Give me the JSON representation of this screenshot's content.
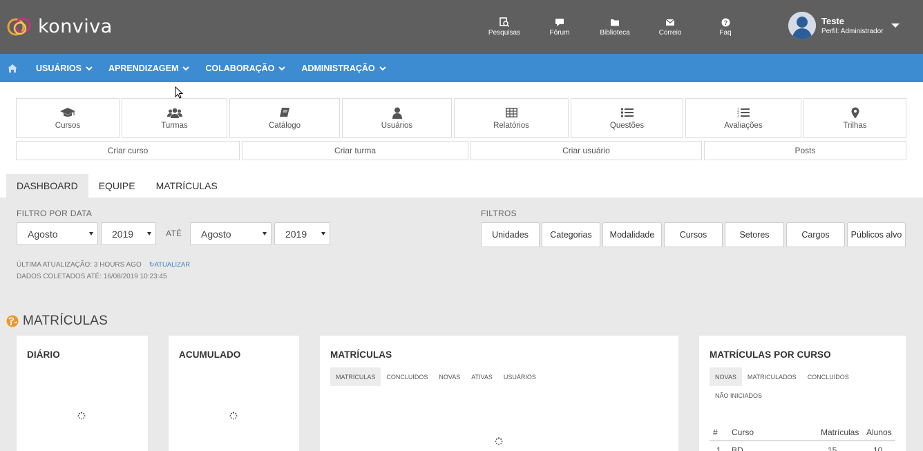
{
  "brand": {
    "name": "konviva"
  },
  "top_icons": [
    {
      "icon": "search-doc-icon",
      "label": "Pesquisas"
    },
    {
      "icon": "chat-icon",
      "label": "Fórum"
    },
    {
      "icon": "folder-icon",
      "label": "Biblioteca"
    },
    {
      "icon": "mail-icon",
      "label": "Correio"
    },
    {
      "icon": "question-icon",
      "label": "Faq"
    }
  ],
  "user": {
    "name": "Teste",
    "role": "Perfil: Administrador"
  },
  "nav": {
    "items": [
      {
        "label": "USUÁRIOS"
      },
      {
        "label": "APRENDIZAGEM"
      },
      {
        "label": "COLABORAÇÃO"
      },
      {
        "label": "ADMINISTRAÇÃO"
      }
    ]
  },
  "quick_tiles": [
    {
      "icon": "graduation-cap-icon",
      "label": "Cursos"
    },
    {
      "icon": "users-icon",
      "label": "Turmas"
    },
    {
      "icon": "book-icon",
      "label": "Catálogo"
    },
    {
      "icon": "user-icon",
      "label": "Usuários"
    },
    {
      "icon": "table-icon",
      "label": "Relatórios"
    },
    {
      "icon": "list-icon",
      "label": "Questões"
    },
    {
      "icon": "ordered-list-icon",
      "label": "Avaliações"
    },
    {
      "icon": "map-marker-icon",
      "label": "Trilhas"
    }
  ],
  "quick_buttons": [
    {
      "label": "Criar curso"
    },
    {
      "label": "Criar turma"
    },
    {
      "label": "Criar usuário"
    },
    {
      "label": "Posts"
    }
  ],
  "tabs": [
    {
      "label": "DASHBOARD"
    },
    {
      "label": "EQUIPE"
    },
    {
      "label": "MATRÍCULAS"
    }
  ],
  "date_filter": {
    "title": "FILTRO POR DATA",
    "from_month": "Agosto",
    "from_year": "2019",
    "until_label": "ATÉ",
    "to_month": "Agosto",
    "to_year": "2019"
  },
  "filters": {
    "title": "FILTROS",
    "buttons": [
      "Unidades",
      "Categorias",
      "Modalidade",
      "Cursos",
      "Setores",
      "Cargos",
      "Públicos alvo"
    ]
  },
  "meta": {
    "last_update": "ÚLTIMA ATUALIZAÇÃO: 3 HOURS AGO",
    "refresh": "ATUALIZAR",
    "collected": "DADOS COLETADOS ATÉ: 16/08/2019 10:23:45"
  },
  "section": {
    "title": "MATRÍCULAS"
  },
  "cards": {
    "diario": {
      "title": "DIÁRIO"
    },
    "acumulado": {
      "title": "ACUMULADO"
    },
    "matriculas": {
      "title": "MATRÍCULAS",
      "tabs": [
        "MATRÍCULAS",
        "CONCLUÍDOS",
        "NOVAS",
        "ATIVAS",
        "USUÁRIOS"
      ]
    },
    "por_curso": {
      "title": "MATRÍCULAS POR CURSO",
      "tabs": [
        "NOVAS",
        "MATRICULADOS",
        "CONCLUÍDOS",
        "NÃO INICIADOS"
      ],
      "columns": [
        "#",
        "Curso",
        "Matrículas",
        "Alunos"
      ],
      "rows": [
        {
          "n": "1",
          "curso": "BD",
          "matriculas": "15",
          "alunos": "10"
        }
      ]
    }
  },
  "colors": {
    "topbar": "#5f5f5f",
    "nav": "#3d8bd0",
    "accent": "#e89a2e"
  }
}
